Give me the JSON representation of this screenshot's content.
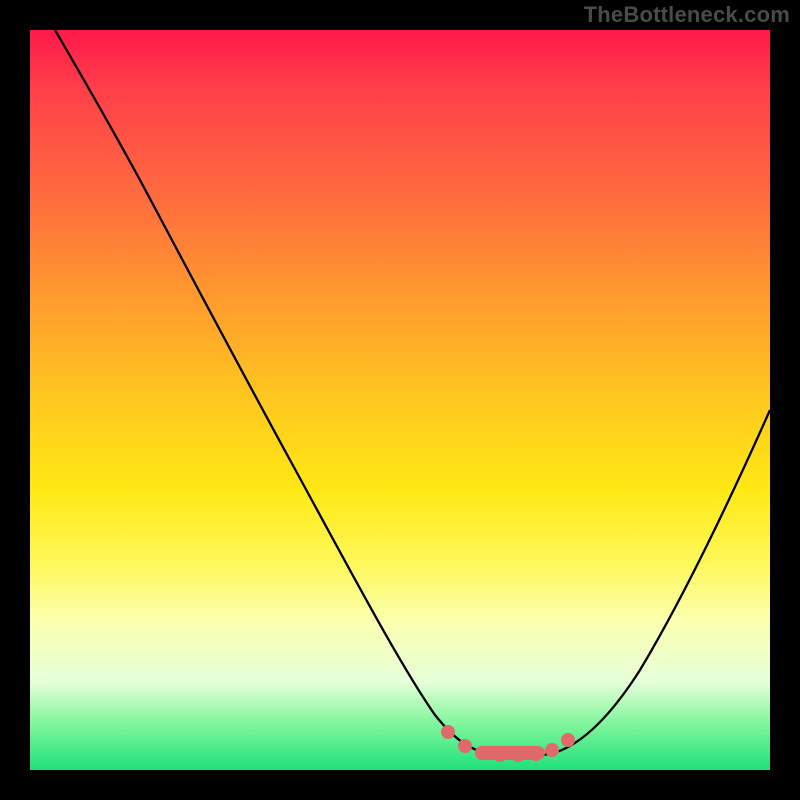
{
  "watermark": "TheBottleneck.com",
  "chart_data": {
    "type": "line",
    "title": "",
    "xlabel": "",
    "ylabel": "",
    "xlim": [
      0,
      100
    ],
    "ylim": [
      0,
      100
    ],
    "series": [
      {
        "name": "bottleneck-curve",
        "x": [
          0,
          8,
          15,
          25,
          35,
          45,
          52,
          57,
          60,
          63,
          67,
          71,
          76,
          82,
          90,
          100
        ],
        "y": [
          100,
          93,
          84,
          66,
          48,
          30,
          16,
          6,
          3,
          2,
          2,
          3,
          8,
          18,
          34,
          55
        ]
      },
      {
        "name": "optimal-band",
        "x": [
          56,
          59,
          62,
          65,
          68,
          71,
          73
        ],
        "y": [
          6,
          3,
          2,
          2,
          2,
          3,
          5
        ]
      }
    ],
    "annotations": [],
    "colors": {
      "curve": "#000000",
      "optimal_band": "#e06a6a",
      "gradient_top": "#ff1a4a",
      "gradient_mid": "#ffe814",
      "gradient_bottom": "#1fe07a",
      "frame": "#000000"
    }
  }
}
